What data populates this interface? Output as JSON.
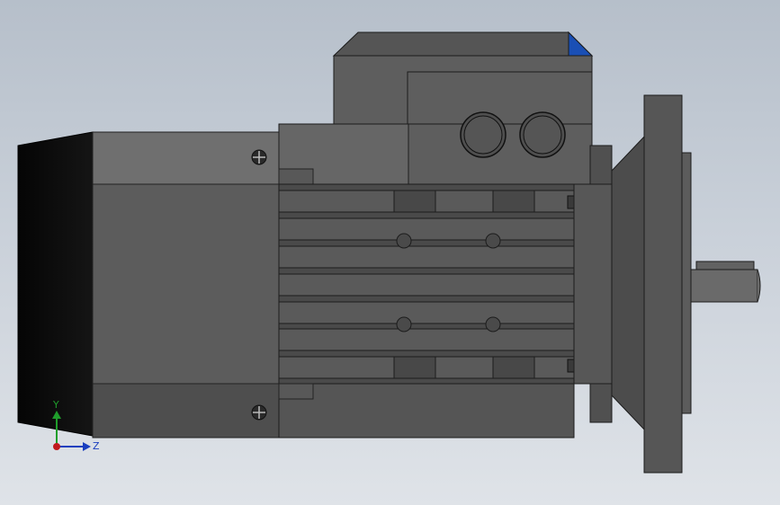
{
  "viewport": {
    "background_top": "#b6bfca",
    "background_bottom": "#dfe3e8"
  },
  "triad": {
    "y_label": "Y",
    "z_label": "Z",
    "y_color": "#1f9d2b",
    "z_color": "#1a3fbf",
    "x_color": "#c0191d"
  },
  "model": {
    "body_color": "#5a5a5a",
    "dark_color": "#1a1a1a",
    "accent_color": "#1a4fb5"
  }
}
